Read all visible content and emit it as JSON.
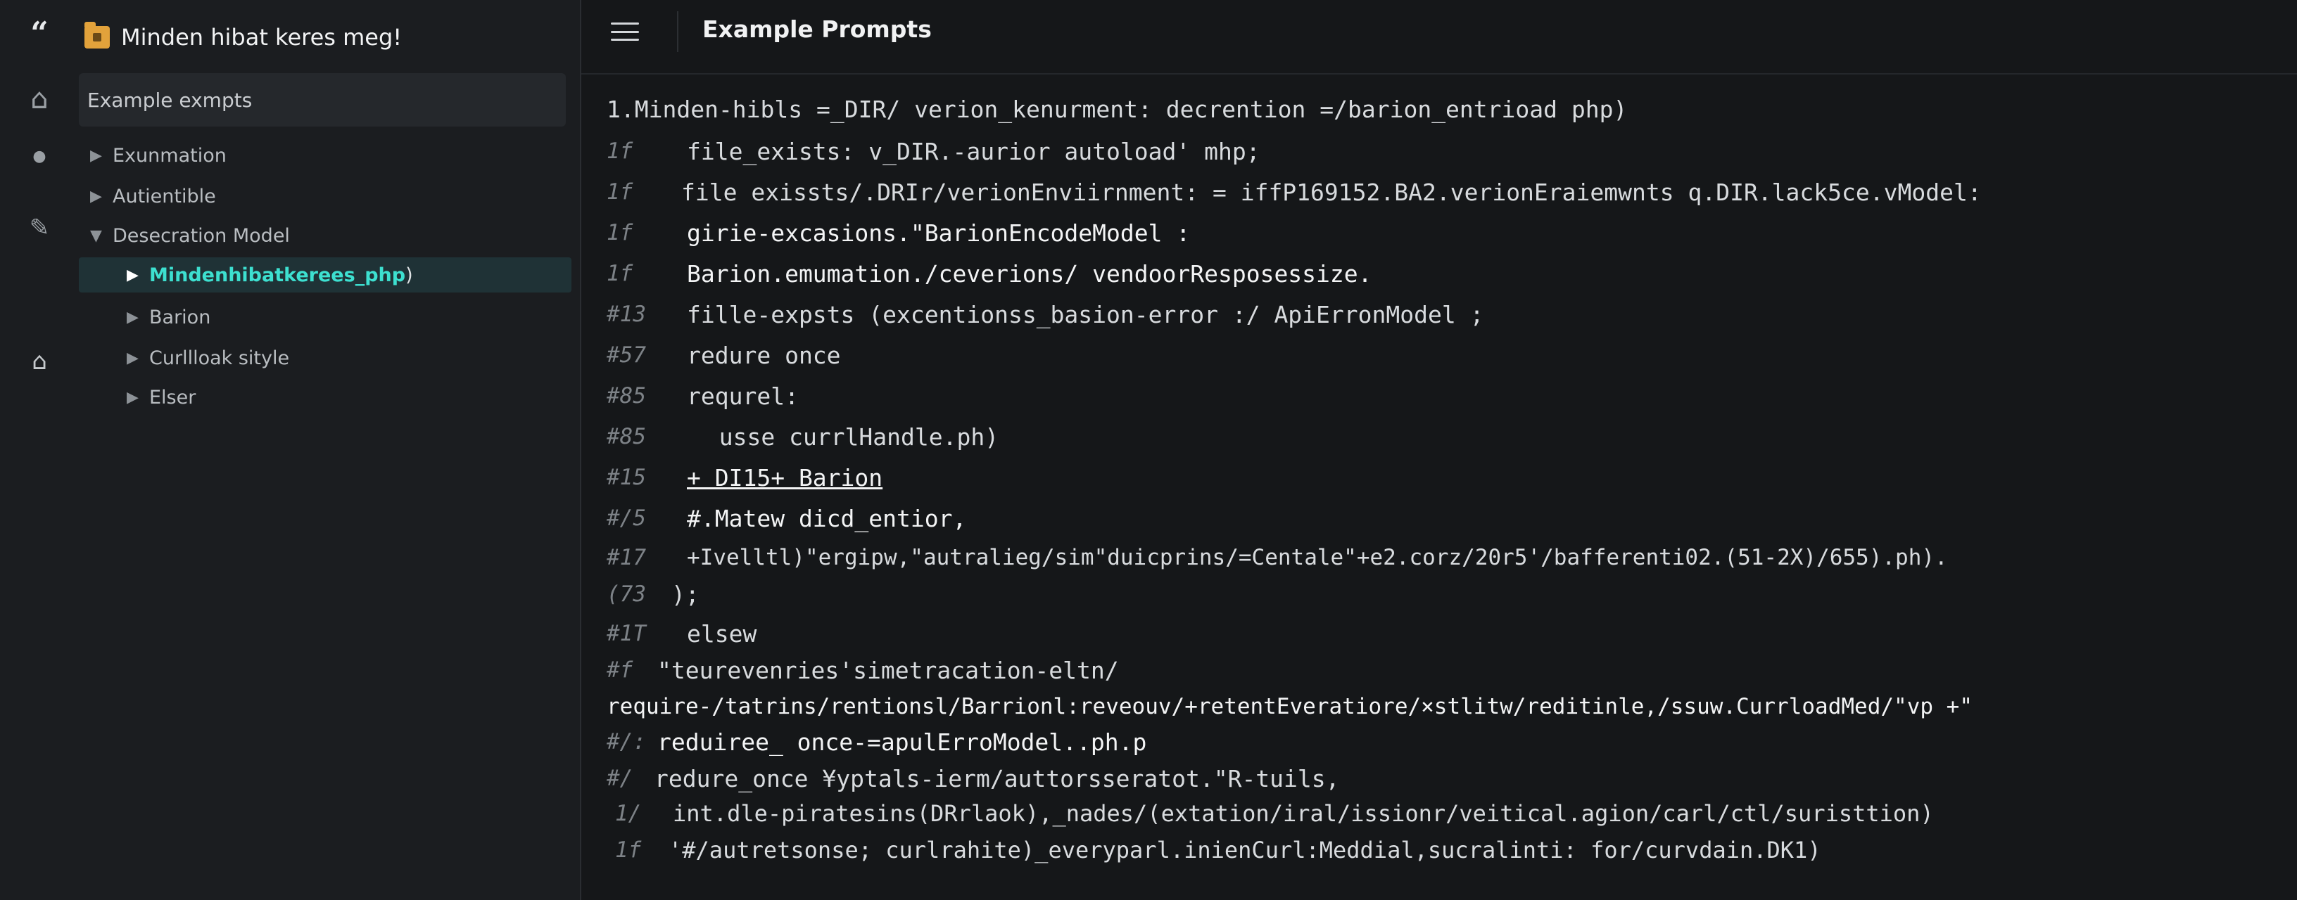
{
  "rail": {
    "icons": [
      "quote-icon",
      "home-icon",
      "dot-icon",
      "brush-icon",
      "home-icon"
    ]
  },
  "sidebar": {
    "title": "Minden hibat keres meg!",
    "search_text": "Example exmpts",
    "items": [
      {
        "label": "Exunmation",
        "expanded": false,
        "level": 0
      },
      {
        "label": "Autientible",
        "expanded": false,
        "level": 0
      },
      {
        "label": "Desecration Model",
        "expanded": true,
        "level": 0
      },
      {
        "label": "Mindenhibatkerees_php",
        "suffix": ")",
        "active": true,
        "level": 1
      },
      {
        "label": "Barion",
        "expanded": false,
        "level": 1
      },
      {
        "label": "Curllloak sityle",
        "expanded": false,
        "level": 1
      },
      {
        "label": "Elser",
        "expanded": false,
        "level": 1
      }
    ]
  },
  "header": {
    "title": "Example Prompts"
  },
  "editor": {
    "lines": [
      {
        "num": "",
        "text": "1.Minden-hibls =_DIR/ verion_kenurment: decrention =/barion_entrioad php)"
      },
      {
        "num": "1f",
        "text": "file_exists: v_DIR.-aurior autoload' mhp;"
      },
      {
        "num": "1f",
        "text": "file exissts/.DRIr/verionEnviirnment: = iffP169152.BA2.verionEraiemwnts q.DIR.lack5ce.vModel:"
      },
      {
        "num": "1f",
        "text": "girie-excasions.\"BarionEncodeModel :"
      },
      {
        "num": "1f",
        "text": "Barion.emumation./ceverions/ vendoorResposessize."
      },
      {
        "num": "#13",
        "text": "fille-expsts (excentionss_basion-error :/ ApiErronModel ;"
      },
      {
        "num": "#57",
        "text": "redure once"
      },
      {
        "num": "#85",
        "text": "requrel:"
      },
      {
        "num": "#85",
        "text": "  usse currlHandle.ph)"
      },
      {
        "num": "#15",
        "text": "+ DI15+ Barion"
      },
      {
        "num": "#/5",
        "text": "#.Matew dicd_entior,"
      },
      {
        "num": "#17",
        "text": "+Ivelltl)\"ergipw,\"autralieg/sim\"duicprins/=Centale\"+e2.corz/20r5'/bafferenti02.(51-2X)/655).ph)."
      },
      {
        "num": "(73",
        "text": ");"
      },
      {
        "num": "#1T",
        "text": "elsew"
      },
      {
        "num": "#f",
        "text": "\"teurevenries'simetracation-eltn/"
      },
      {
        "num": "",
        "text": "require-/tatrins/rentionsl/Barrionl:reveouv/+retentEveratiore/×stlitw/reditinle,/ssuw.CurrloadMed/\"vp +\""
      },
      {
        "num": "#/:",
        "text": "reduiree_ once-=apulErroModel..ph.p"
      },
      {
        "num": "#/",
        "text": "redure_once ¥yptals-ierm/auttorsseratot.\"R-tuils,"
      },
      {
        "num": "1/",
        "text": "int.dle-piratesins(DRrlaok),_nades/(extation/iral/issionr/veitical.agion/carl/ctl/suristtion)"
      },
      {
        "num": "1f",
        "text": "'#/autretsonse; curlrahite)_everyparl.inienCurl:Meddial,sucralinti: for/curvdain.DK1)"
      }
    ]
  }
}
